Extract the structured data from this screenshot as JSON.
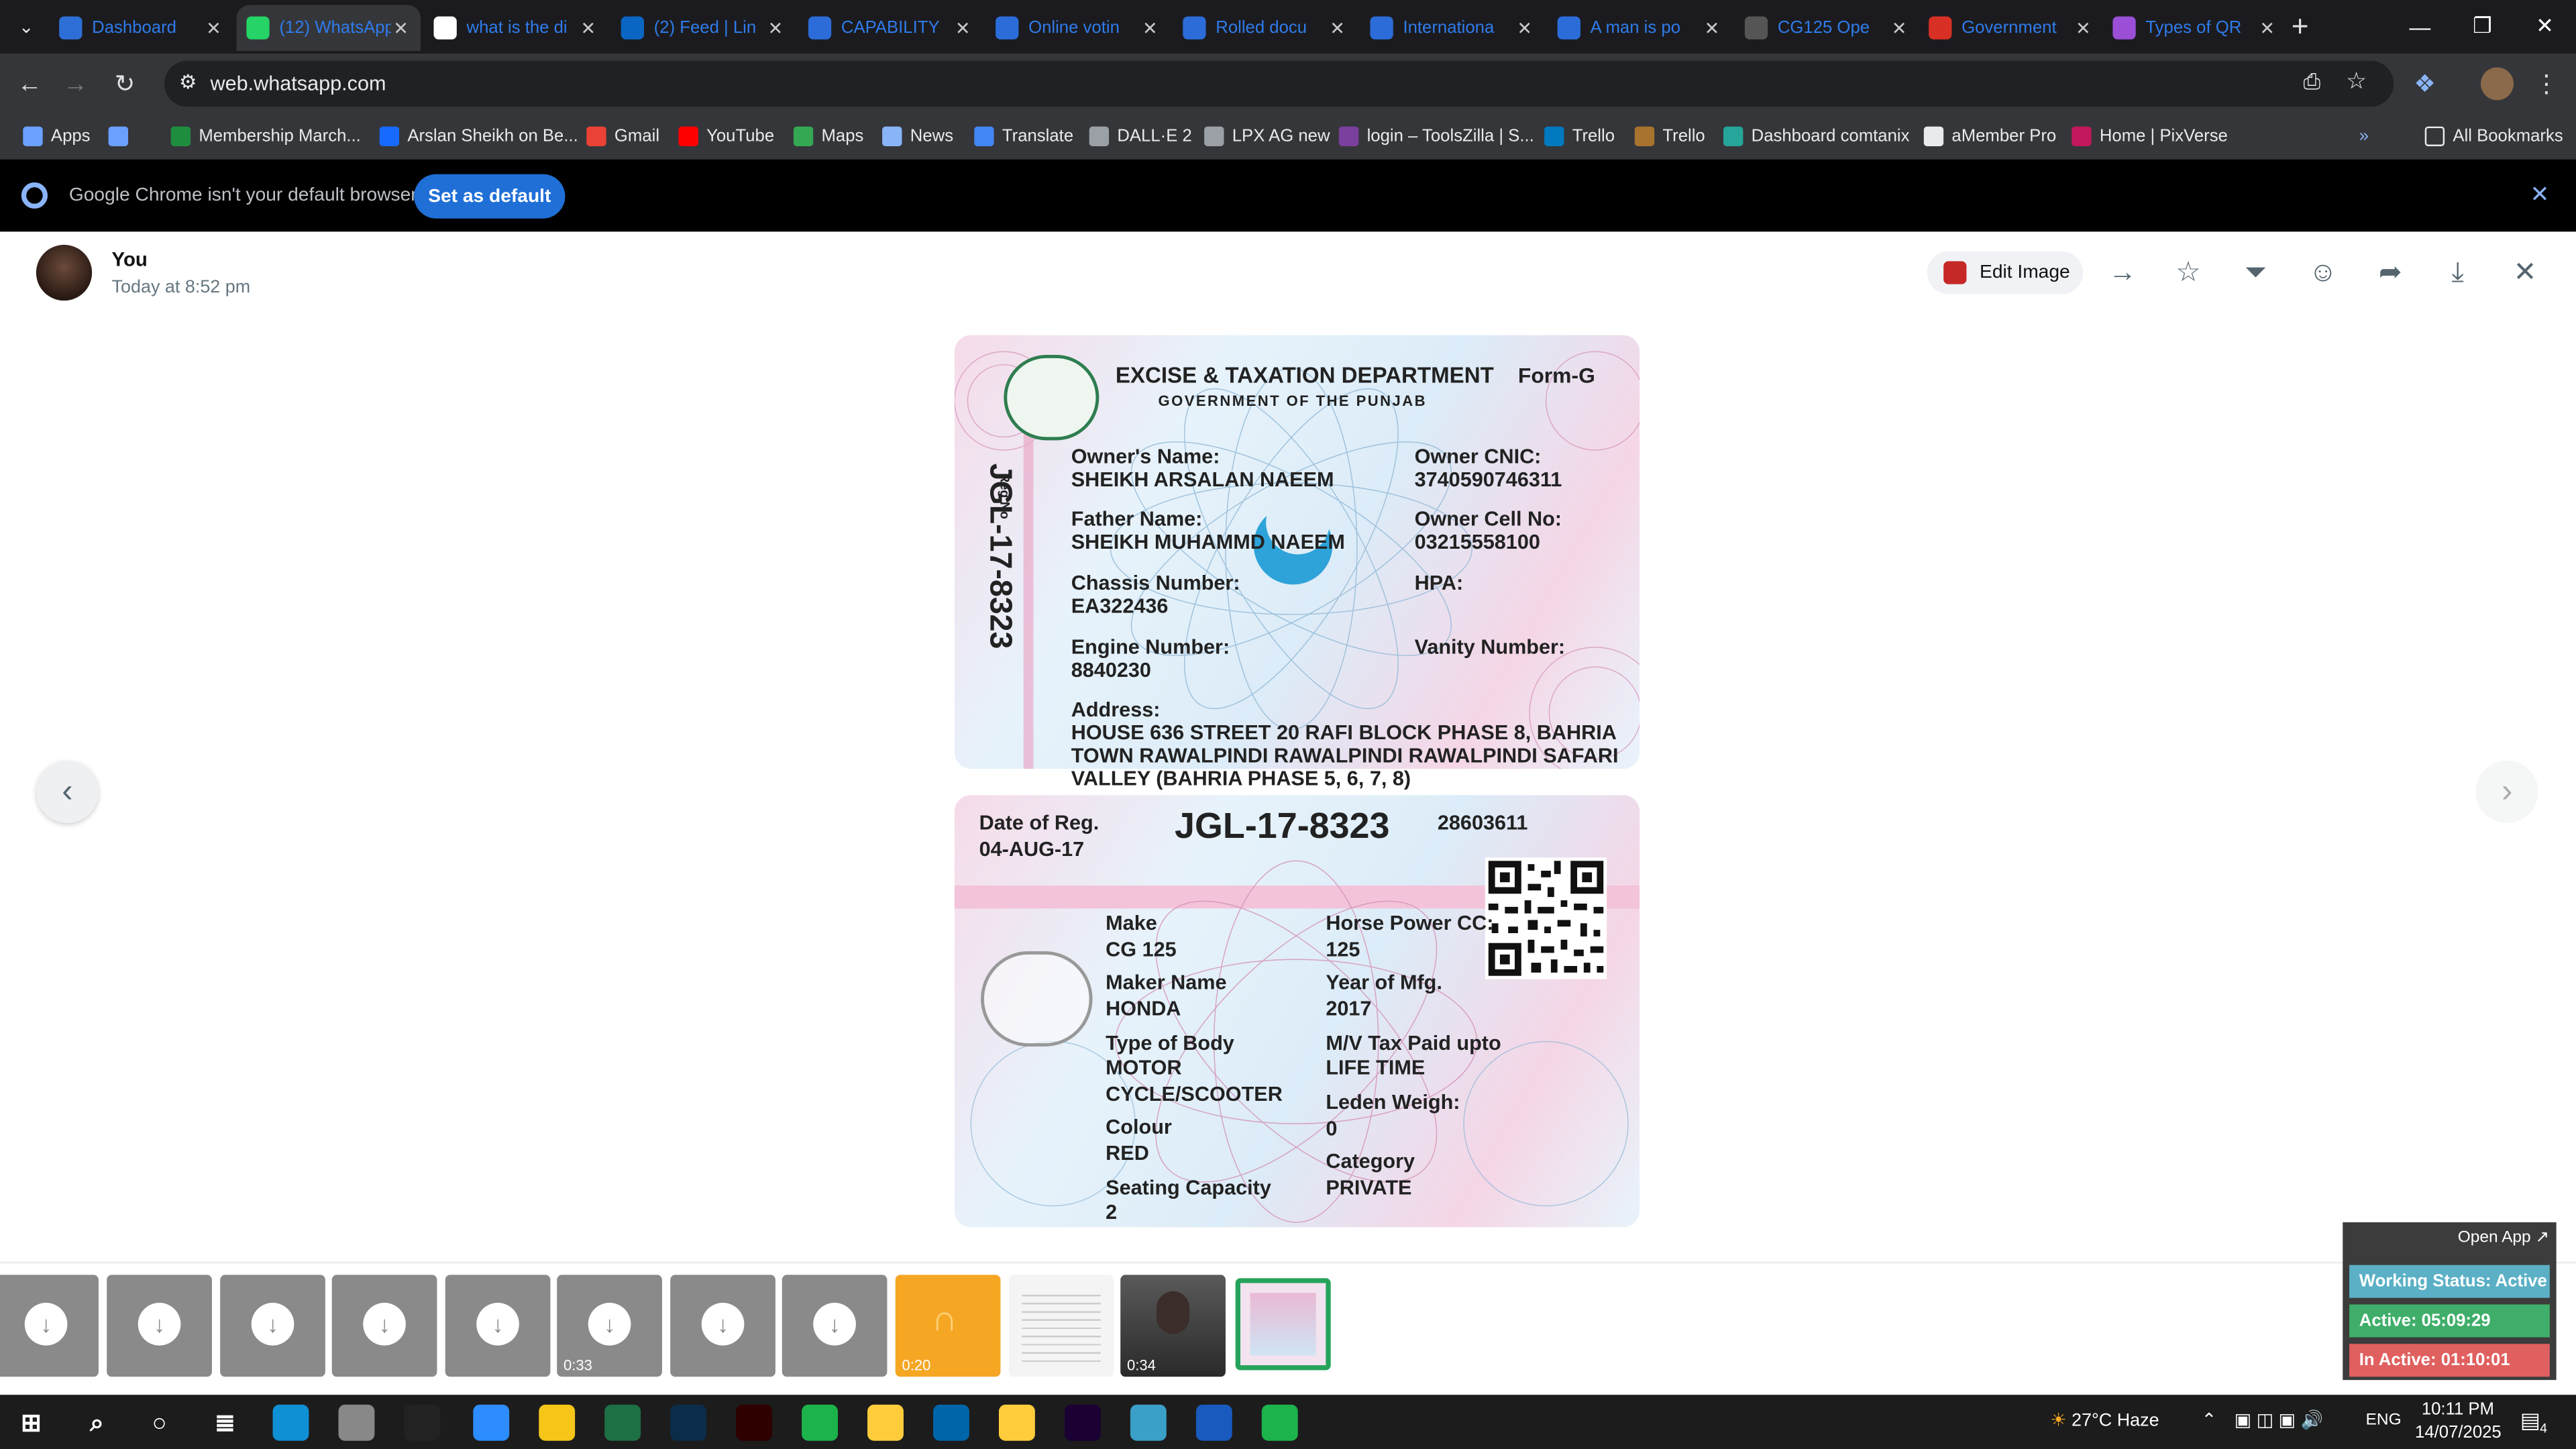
{
  "tabs": [
    {
      "label": "Dashboard",
      "icon": "d-icon",
      "color": "#2d6fd6"
    },
    {
      "label": "(12) WhatsApp",
      "icon": "whatsapp-icon",
      "color": "#25d366"
    },
    {
      "label": "what is the di",
      "icon": "google-icon",
      "color": "#ffffff"
    },
    {
      "label": "(2) Feed | Lin",
      "icon": "linkedin-icon",
      "color": "#0a66c2"
    },
    {
      "label": "CAPABILITY",
      "icon": "forms-icon",
      "color": "#2b6cd8"
    },
    {
      "label": "Online votin",
      "icon": "forms-icon",
      "color": "#2b6cd8"
    },
    {
      "label": "Rolled docu",
      "icon": "forms-icon",
      "color": "#2b6cd8"
    },
    {
      "label": "Internationa",
      "icon": "forms-icon",
      "color": "#2b6cd8"
    },
    {
      "label": "A man is po",
      "icon": "forms-icon",
      "color": "#2b6cd8"
    },
    {
      "label": "CG125 Ope",
      "icon": "chatgpt-icon",
      "color": "#555555"
    },
    {
      "label": "Government",
      "icon": "gemini-icon",
      "color": "#d93025"
    },
    {
      "label": "Types of QR",
      "icon": "img-icon",
      "color": "#9a4fd6"
    }
  ],
  "address": {
    "url": "web.whatsapp.com"
  },
  "bookmarks": [
    {
      "label": "Apps",
      "color": "#6aa0ff"
    },
    {
      "label": "",
      "color": "#6aa0ff"
    },
    {
      "label": "Membership March...",
      "color": "#1e8e3e"
    },
    {
      "label": "Arslan Sheikh on Be...",
      "color": "#1769ff"
    },
    {
      "label": "Gmail",
      "color": "#ea4335"
    },
    {
      "label": "YouTube",
      "color": "#ff0000"
    },
    {
      "label": "Maps",
      "color": "#34a853"
    },
    {
      "label": "News",
      "color": "#8ab4f8"
    },
    {
      "label": "Translate",
      "color": "#4285f4"
    },
    {
      "label": "DALL·E 2",
      "color": "#9aa0a6"
    },
    {
      "label": "LPX AG new",
      "color": "#9aa0a6"
    },
    {
      "label": "login – ToolsZilla | S...",
      "color": "#7b3f9e"
    },
    {
      "label": "Trello",
      "color": "#0079bf"
    },
    {
      "label": "Trello",
      "color": "#a8732e"
    },
    {
      "label": "Dashboard comtanix",
      "color": "#26a69a"
    },
    {
      "label": "aMember Pro",
      "color": "#e8eaed"
    },
    {
      "label": "Home | PixVerse",
      "color": "#c2185b"
    }
  ],
  "all_bookmarks": "All Bookmarks",
  "default_bar": {
    "message": "Google Chrome isn't your default browser",
    "button": "Set as default"
  },
  "viewer": {
    "sender": "You",
    "time": "Today at 8:52 pm",
    "edit_label": "Edit Image"
  },
  "card_top": {
    "department": "EXCISE & TAXATION DEPARTMENT",
    "government": "GOVERNMENT OF THE PUNJAB",
    "form": "Form-G",
    "reg_no_label": "Reg No",
    "reg_no": "JGL-17-8323",
    "owner_name_label": "Owner's Name:",
    "owner_name": "SHEIKH ARSALAN NAEEM",
    "owner_cnic_label": "Owner CNIC:",
    "owner_cnic": "3740590746311",
    "father_label": "Father Name:",
    "father": "SHEIKH MUHAMMD NAEEM",
    "cell_label": "Owner Cell No:",
    "cell": "03215558100",
    "chassis_label": "Chassis Number:",
    "chassis": "EA322436",
    "hpa_label": "HPA:",
    "engine_label": "Engine Number:",
    "engine": "8840230",
    "vanity_label": "Vanity Number:",
    "address_label": "Address:",
    "address_lines": [
      "HOUSE 636 STREET 20 RAFI BLOCK PHASE 8, BAHRIA",
      "TOWN RAWALPINDI RAWALPINDI RAWALPINDI SAFARI",
      "VALLEY (BAHRIA PHASE 5, 6, 7, 8)"
    ]
  },
  "card_bottom": {
    "date_label": "Date of Reg.",
    "date": "04-AUG-17",
    "reg_no": "JGL-17-8323",
    "serial": "28603611",
    "make_label": "Make",
    "make": "CG 125",
    "hp_label": "Horse Power CC:",
    "hp": "125",
    "maker_label": "Maker Name",
    "maker": "HONDA",
    "year_label": "Year of Mfg.",
    "year": "2017",
    "body_label": "Type of Body",
    "body_1": "MOTOR",
    "body_2": "CYCLE/SCOOTER",
    "tax_label": "M/V Tax Paid upto",
    "tax": "LIFE TIME",
    "laden_label": "Leden Weigh:",
    "laden": "0",
    "colour_label": "Colour",
    "colour": "RED",
    "category_label": "Category",
    "category": "PRIVATE",
    "seating_label": "Seating Capacity",
    "seating": "2"
  },
  "thumbnails": [
    {
      "type": "download",
      "duration": ""
    },
    {
      "type": "download",
      "duration": ""
    },
    {
      "type": "download",
      "duration": ""
    },
    {
      "type": "download",
      "duration": ""
    },
    {
      "type": "download",
      "duration": ""
    },
    {
      "type": "download",
      "duration": "0:33"
    },
    {
      "type": "download",
      "duration": ""
    },
    {
      "type": "download",
      "duration": ""
    },
    {
      "type": "audio",
      "duration": "0:20"
    },
    {
      "type": "document",
      "duration": ""
    },
    {
      "type": "video",
      "duration": "0:34"
    },
    {
      "type": "image",
      "duration": ""
    }
  ],
  "monitor": {
    "open_app": "Open App ↗",
    "working": "Working Status: Active",
    "active": "Active: 05:09:29",
    "inactive": "In Active: 01:10:01",
    "colors": {
      "working": "#5bb0c6",
      "active": "#3fae6a",
      "inactive": "#e0605f"
    }
  },
  "taskbar": {
    "weather": "27°C  Haze",
    "lang": "ENG",
    "time": "10:11 PM",
    "date": "14/07/2025",
    "notifications": "4",
    "apps": [
      "start-icon",
      "search-icon",
      "cortana-icon",
      "taskview-icon",
      "edge-icon",
      "pen-icon",
      "terminal-icon",
      "zoom-icon",
      "explorer-icon",
      "excel-icon",
      "photoshop-icon",
      "illustrator-icon",
      "camtasia-icon",
      "chrome-icon",
      "vscode-icon",
      "chrome-profile-icon",
      "premiere-icon",
      "app-icon",
      "word-icon",
      "camtasia2-icon"
    ]
  }
}
